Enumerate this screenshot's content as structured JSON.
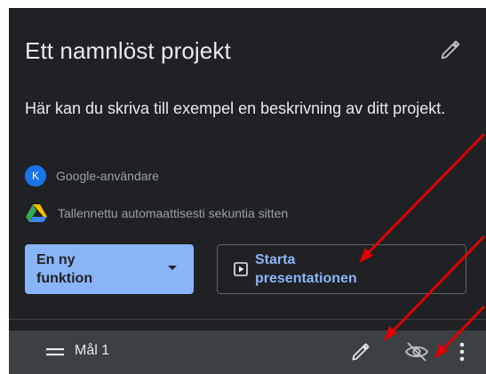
{
  "project": {
    "title": "Ett namnlöst projekt",
    "description": "Här kan du skriva till exempel en beskrivning av ditt projekt.",
    "owner_initial": "K",
    "owner_name": "Google-användare",
    "saved_status": "Tallennettu automaattisesti sekuntia sitten"
  },
  "actions": {
    "new_feature_label": "En ny funktion",
    "present_label": "Starta presentationen"
  },
  "layer": {
    "name": "Mål 1"
  },
  "colors": {
    "panel_background": "#202124",
    "layer_bar_background": "#3c4043",
    "accent_blue": "#8ab4f8",
    "avatar_blue": "#1a73e8",
    "annotation_arrow": "#e00000"
  },
  "icons": {
    "title_edit": "pencil-icon",
    "owner": "avatar",
    "saved": "google-drive-icon",
    "new_feature_dropdown": "caret-down-icon",
    "present": "play-icon",
    "layer_handle": "drag-handle-icon",
    "layer_edit": "pencil-icon",
    "layer_visibility": "eye-off-icon",
    "layer_menu": "more-vert-icon"
  }
}
